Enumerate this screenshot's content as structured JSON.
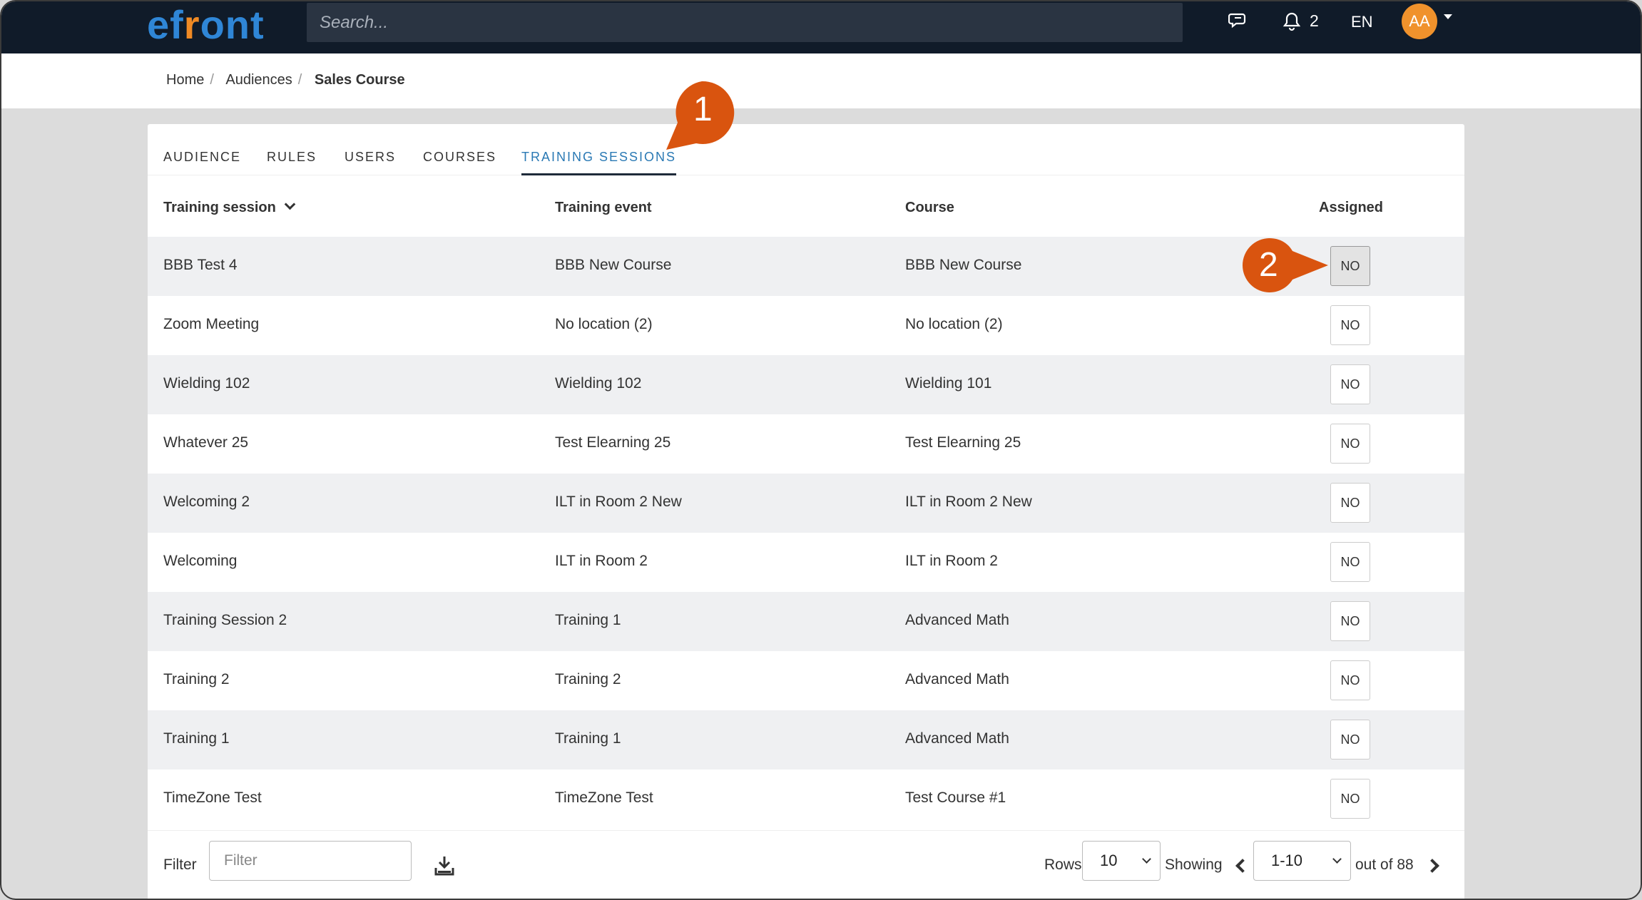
{
  "app": {
    "logo": "efront",
    "search_placeholder": "Search...",
    "notifications_count": "2",
    "language": "EN",
    "user_initials": "AA"
  },
  "breadcrumb": {
    "items": [
      "Home",
      "Audiences"
    ],
    "current": "Sales Course"
  },
  "tabs": [
    {
      "label": "AUDIENCE",
      "active": false
    },
    {
      "label": "RULES",
      "active": false
    },
    {
      "label": "USERS",
      "active": false
    },
    {
      "label": "COURSES",
      "active": false
    },
    {
      "label": "TRAINING SESSIONS",
      "active": true
    }
  ],
  "table": {
    "columns": [
      "Training session",
      "Training event",
      "Course",
      "Assigned"
    ],
    "rows": [
      {
        "session": "BBB Test 4",
        "event": "BBB New Course",
        "course": "BBB New Course",
        "assigned": "NO"
      },
      {
        "session": "Zoom Meeting",
        "event": "No location (2)",
        "course": "No location (2)",
        "assigned": "NO"
      },
      {
        "session": "Wielding 102",
        "event": "Wielding 102",
        "course": "Wielding 101",
        "assigned": "NO"
      },
      {
        "session": "Whatever 25",
        "event": "Test Elearning 25",
        "course": "Test Elearning 25",
        "assigned": "NO"
      },
      {
        "session": "Welcoming 2",
        "event": "ILT in Room 2 New",
        "course": "ILT in Room 2 New",
        "assigned": "NO"
      },
      {
        "session": "Welcoming",
        "event": "ILT in Room 2",
        "course": "ILT in Room 2",
        "assigned": "NO"
      },
      {
        "session": "Training Session 2",
        "event": "Training 1",
        "course": "Advanced Math",
        "assigned": "NO"
      },
      {
        "session": "Training 2",
        "event": "Training 2",
        "course": "Advanced Math",
        "assigned": "NO"
      },
      {
        "session": "Training 1",
        "event": "Training 1",
        "course": "Advanced Math",
        "assigned": "NO"
      },
      {
        "session": "TimeZone Test",
        "event": "TimeZone Test",
        "course": "Test Course #1",
        "assigned": "NO"
      }
    ]
  },
  "footer": {
    "filter_label": "Filter",
    "filter_placeholder": "Filter",
    "rows_label": "Rows",
    "rows_value": "10",
    "showing_label": "Showing",
    "range_value": "1-10",
    "out_of_label": "out of 88"
  },
  "callouts": [
    "1",
    "2"
  ],
  "colors": {
    "topbar": "#101b29",
    "accent_tab": "#2a79b4",
    "callout": "#d9540f",
    "avatar": "#f0922c"
  }
}
